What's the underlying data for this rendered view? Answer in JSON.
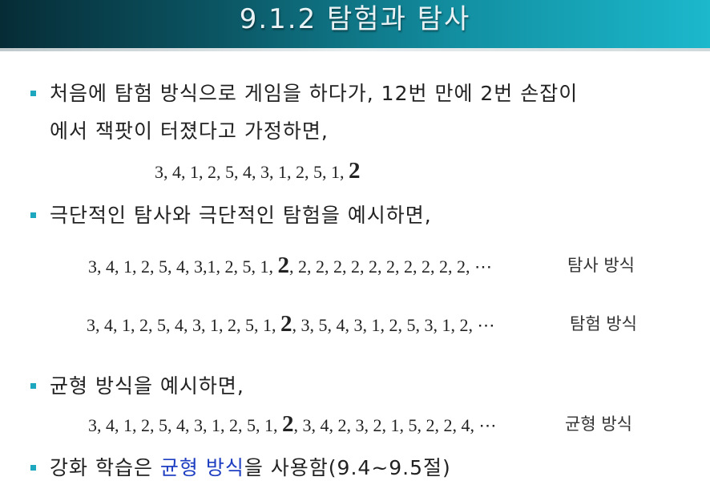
{
  "slide": {
    "title": "9.1.2 탐험과 탐사"
  },
  "bullets": [
    {
      "line1": "처음에 탐험 방식으로 게임을 하다가, 12번 만에  2번 손잡이",
      "line2": "에서 잭팟이 터졌다고 가정하면,"
    },
    {
      "text": "극단적인 탐사와 극단적인 탐험을 예시하면,"
    },
    {
      "text": "균형 방식을 예시하면,"
    },
    {
      "pre": "강화 학습은 ",
      "highlight": "균형 방식",
      "post": "을 사용함(9.4~9.5절)"
    }
  ],
  "sequences": {
    "initial": {
      "prefix": "3, 4, 1, 2, 5, 4, 3, 1, 2, 5, 1, ",
      "bold": "2"
    },
    "exploit": {
      "prefix": "3, 4, 1, 2, 5, 4, 3,1, 2, 5, 1, ",
      "bold": "2",
      "suffix": ", 2, 2, 2, 2, 2, 2, 2, 2, 2, 2,  ⋯",
      "label": "탐사 방식"
    },
    "explore": {
      "prefix": "3, 4, 1, 2, 5, 4, 3, 1, 2, 5, 1, ",
      "bold": "2",
      "suffix": ", 3, 5, 4, 3, 1, 2, 5, 3, 1, 2,  ⋯",
      "label": "탐험 방식"
    },
    "balanced": {
      "prefix": "3, 4, 1, 2, 5, 4, 3, 1, 2, 5, 1, ",
      "bold": "2",
      "suffix": ", 3, 4, 2, 3, 2, 1, 5, 2, 2, 4,  ⋯",
      "label": "균형 방식"
    }
  },
  "colors": {
    "bullet": "#1ea8bf",
    "highlight": "#1f3fc2",
    "header_dark": "#062c36",
    "header_light": "#1cb8cc"
  }
}
